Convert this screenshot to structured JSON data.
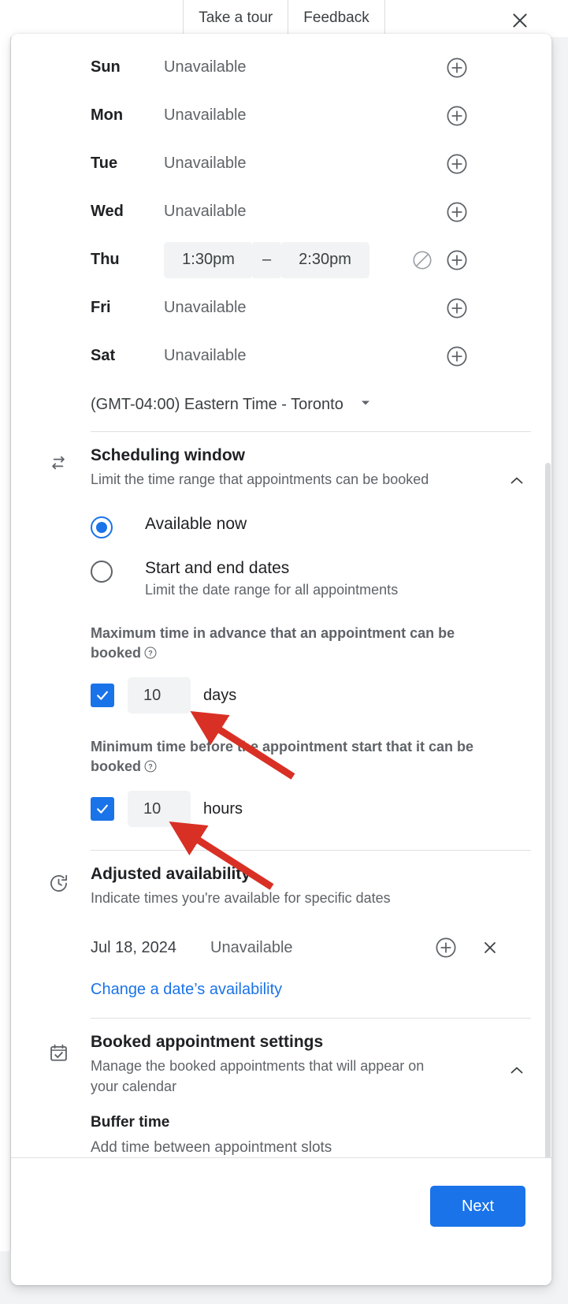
{
  "topbar": {
    "take_a_tour": "Take a tour",
    "feedback": "Feedback",
    "close_icon": "close-icon"
  },
  "availability": {
    "days": [
      {
        "day": "Sun",
        "status": "Unavailable",
        "has_times": false
      },
      {
        "day": "Mon",
        "status": "Unavailable",
        "has_times": false
      },
      {
        "day": "Tue",
        "status": "Unavailable",
        "has_times": false
      },
      {
        "day": "Wed",
        "status": "Unavailable",
        "has_times": false
      },
      {
        "day": "Thu",
        "status": "",
        "has_times": true,
        "start": "1:30pm",
        "dash": "–",
        "end": "2:30pm"
      },
      {
        "day": "Fri",
        "status": "Unavailable",
        "has_times": false
      },
      {
        "day": "Sat",
        "status": "Unavailable",
        "has_times": false
      }
    ],
    "timezone": "(GMT-04:00) Eastern Time - Toronto"
  },
  "scheduling_window": {
    "icon": "swap-horizontal-icon",
    "title": "Scheduling window",
    "subtitle": "Limit the time range that appointments can be booked",
    "collapse_icon": "chevron-up-icon",
    "options": [
      {
        "label": "Available now",
        "sublabel": "",
        "selected": true
      },
      {
        "label": "Start and end dates",
        "sublabel": "Limit the date range for all appointments",
        "selected": false
      }
    ],
    "max_advance": {
      "label": "Maximum time in advance that an appointment can be booked",
      "checked": true,
      "value": "10",
      "unit": "days"
    },
    "min_before": {
      "label": "Minimum time before the appointment start that it can be booked",
      "checked": true,
      "value": "10",
      "unit": "hours"
    }
  },
  "adjusted_availability": {
    "icon": "history-clock-icon",
    "title": "Adjusted availability",
    "subtitle": "Indicate times you're available for specific dates",
    "entries": [
      {
        "date": "Jul 18, 2024",
        "status": "Unavailable"
      }
    ],
    "change_link": "Change a date’s availability"
  },
  "booked_settings": {
    "icon": "calendar-check-icon",
    "title": "Booked appointment settings",
    "subtitle": "Manage the booked appointments that will appear on your calendar",
    "collapse_icon": "chevron-up-icon",
    "buffer": {
      "title": "Buffer time",
      "description": "Add time between appointment slots"
    }
  },
  "footer": {
    "next_label": "Next"
  },
  "colors": {
    "accent": "#1a73e8",
    "field_bg": "#f1f3f4",
    "text_primary": "#202124",
    "text_secondary": "#5f6368",
    "annotation_arrow": "#d93025"
  }
}
